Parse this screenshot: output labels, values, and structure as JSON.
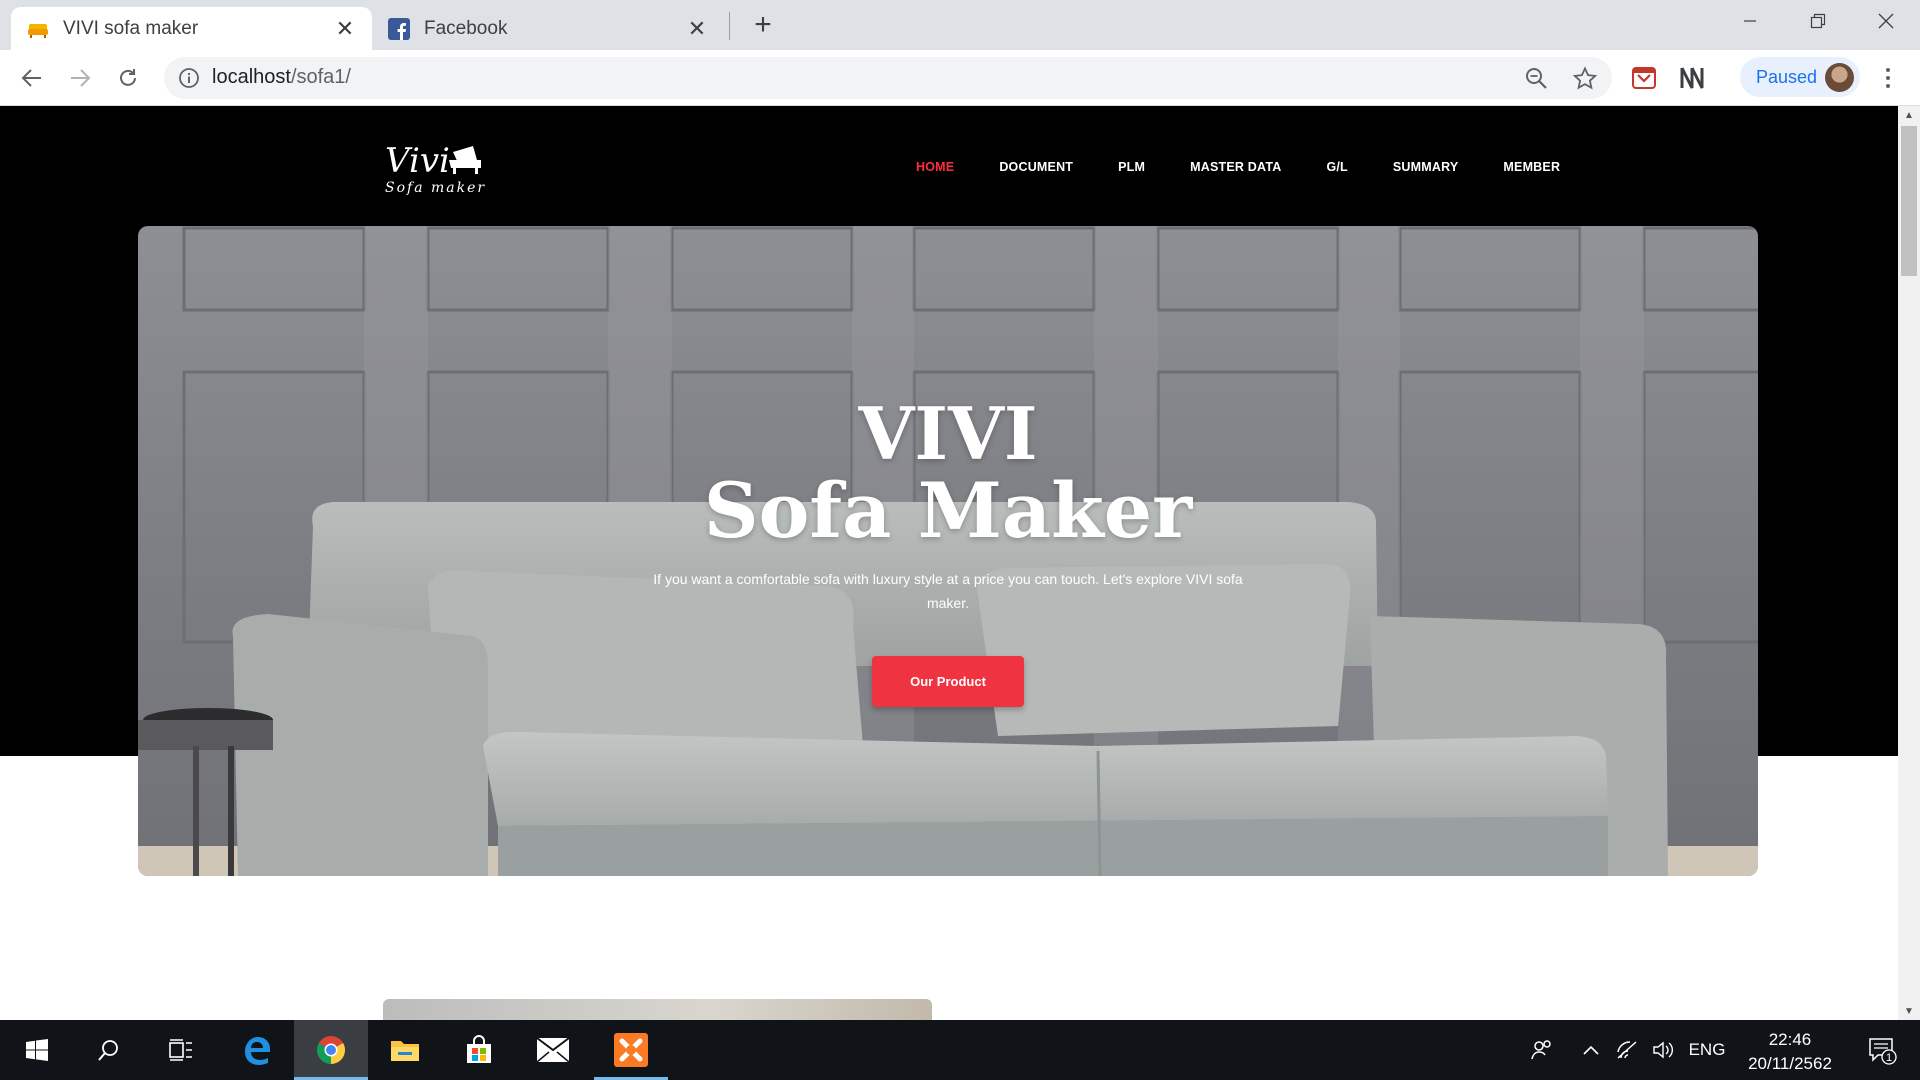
{
  "browser": {
    "tabs": [
      {
        "title": "VIVI sofa maker",
        "active": true,
        "icon": "sofa-favicon"
      },
      {
        "title": "Facebook",
        "active": false,
        "icon": "facebook-favicon"
      }
    ],
    "url_host": "localhost",
    "url_path": "/sofa1/",
    "profile_label": "Paused"
  },
  "site": {
    "logo_text_top": "Vivi",
    "logo_text_bottom": "Sofa maker",
    "nav": [
      {
        "label": "HOME",
        "active": true
      },
      {
        "label": "DOCUMENT",
        "active": false
      },
      {
        "label": "PLM",
        "active": false
      },
      {
        "label": "MASTER DATA",
        "active": false
      },
      {
        "label": "G/L",
        "active": false
      },
      {
        "label": "SUMMARY",
        "active": false
      },
      {
        "label": "MEMBER",
        "active": false
      }
    ],
    "hero": {
      "title_line1": "VIVI",
      "title_line2": "Sofa Maker",
      "subtitle": "If you want a comfortable sofa with luxury style at a price you can touch. Let's explore VIVI sofa maker.",
      "cta_label": "Our Product"
    }
  },
  "taskbar": {
    "language": "ENG",
    "time": "22:46",
    "date": "20/11/2562",
    "notification_count": "1"
  },
  "colors": {
    "accent_red": "#ef3340",
    "nav_active": "#ff2d3d",
    "page_band": "#000000"
  }
}
